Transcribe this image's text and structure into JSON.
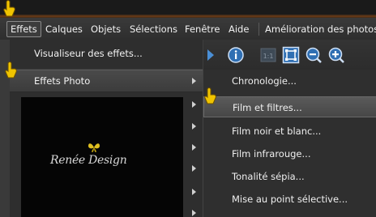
{
  "menubar": {
    "items": [
      {
        "label": "Effets"
      },
      {
        "label": "Calques"
      },
      {
        "label": "Objets"
      },
      {
        "label": "Sélections"
      },
      {
        "label": "Fenêtre"
      },
      {
        "label": "Aide"
      },
      {
        "label": "Amélioration des photos"
      }
    ]
  },
  "toolbar": {
    "icons": [
      "arrow-right-icon",
      "info-icon",
      "actual-size-icon",
      "fit-screen-icon",
      "zoom-out-icon",
      "zoom-in-icon"
    ]
  },
  "effects_menu": {
    "items": [
      {
        "label": "Visualiseur des effets..."
      },
      {
        "label": "Effets Photo"
      }
    ]
  },
  "photo_effects_submenu": {
    "items": [
      {
        "label": "Chronologie..."
      },
      {
        "label": "Film et filtres..."
      },
      {
        "label": "Film noir et blanc..."
      },
      {
        "label": "Film infrarouge..."
      },
      {
        "label": "Tonalité sépia..."
      },
      {
        "label": "Mise au point sélective..."
      }
    ]
  },
  "canvas": {
    "logo_text": "Renée Design"
  },
  "colors": {
    "menu_bg": "#2e2e2e",
    "hover_bg": "#4a4a4a",
    "zoom_blue": "#2f6fb3",
    "pointer_yellow": "#f0c400"
  }
}
